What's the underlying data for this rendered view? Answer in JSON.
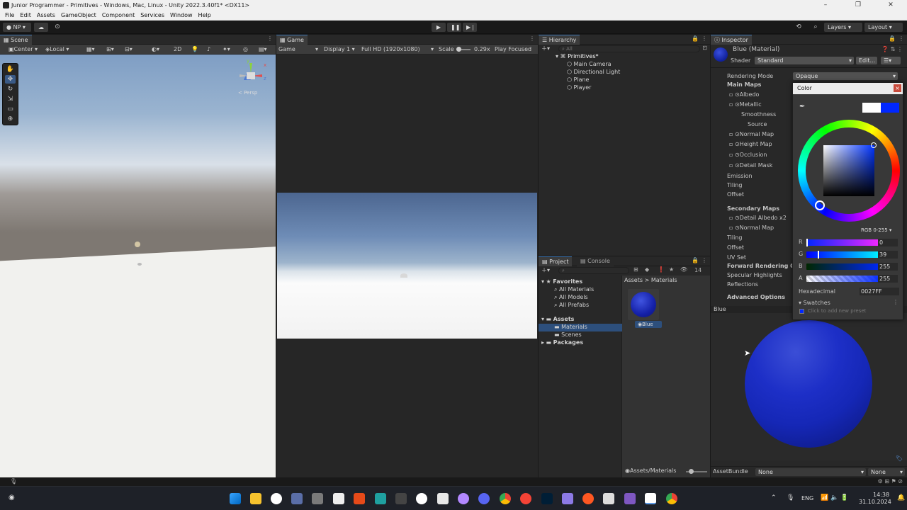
{
  "window": {
    "title": "Junior Programmer - Primitives - Windows, Mac, Linux - Unity 2022.3.40f1* <DX11>",
    "controls": [
      "–",
      "❐",
      "✕"
    ]
  },
  "menu": [
    "File",
    "Edit",
    "Assets",
    "GameObject",
    "Component",
    "Services",
    "Window",
    "Help"
  ],
  "toolbar": {
    "account": "NP",
    "layers": "Layers",
    "layout": "Layout"
  },
  "scene": {
    "tab": "Scene",
    "pivot": "Center",
    "space": "Local",
    "mode2d": "2D",
    "persp": "< Persp",
    "gizmo_y": "y",
    "gizmo_x": "x",
    "gizmo_z": "z"
  },
  "game": {
    "tab": "Game",
    "mode": "Game",
    "display": "Display 1",
    "resolution": "Full HD (1920x1080)",
    "scale_label": "Scale",
    "scale_value": "0.29x",
    "play_focused": "Play Focused"
  },
  "hierarchy": {
    "tab": "Hierarchy",
    "search_placeholder": "All",
    "root": "Primitives*",
    "children": [
      "Main Camera",
      "Directional Light",
      "Plane",
      "Player"
    ]
  },
  "project": {
    "tab_project": "Project",
    "tab_console": "Console",
    "hidden_count": "14",
    "breadcrumb_root": "Assets",
    "breadcrumb_leaf": "Materials",
    "favorites": "Favorites",
    "favorite_items": [
      "All Materials",
      "All Models",
      "All Prefabs"
    ],
    "assets": "Assets",
    "asset_items": [
      "Materials",
      "Scenes"
    ],
    "packages": "Packages",
    "asset_name": "Blue",
    "footer_path": "Assets/Materials"
  },
  "inspector": {
    "tab": "Inspector",
    "title": "Blue (Material)",
    "shader_label": "Shader",
    "shader_value": "Standard",
    "edit_button": "Edit...",
    "rendering_mode_label": "Rendering Mode",
    "rendering_mode_value": "Opaque",
    "main_maps": "Main Maps",
    "albedo": "Albedo",
    "metallic": "Metallic",
    "smoothness": "Smoothness",
    "source": "Source",
    "normal_map": "Normal Map",
    "height_map": "Height Map",
    "occlusion": "Occlusion",
    "detail_mask": "Detail Mask",
    "emission": "Emission",
    "tiling": "Tiling",
    "offset": "Offset",
    "secondary_maps": "Secondary Maps",
    "detail_albedo": "Detail Albedo x2",
    "normal_map2": "Normal Map",
    "tiling2": "Tiling",
    "offset2": "Offset",
    "uv_set": "UV Set",
    "forward_rendering": "Forward Rendering Opti",
    "specular_highlights": "Specular Highlights",
    "reflections": "Reflections",
    "advanced_options": "Advanced Options",
    "preview_label": "Blue",
    "assetbundle_label": "AssetBundle",
    "assetbundle_value": "None",
    "assetbundle_variant": "None"
  },
  "color_picker": {
    "title": "Color",
    "mode": "RGB 0-255",
    "r_label": "R",
    "g_label": "G",
    "b_label": "B",
    "a_label": "A",
    "r": "0",
    "g": "39",
    "b": "255",
    "a": "255",
    "hex_label": "Hexadecimal",
    "hex": "0027FF",
    "swatches": "Swatches",
    "add_preset": "Click to add new preset",
    "color": "#0027ff"
  },
  "taskbar": {
    "lang": "ENG",
    "time": "14:38",
    "date": "31.10.2024"
  }
}
